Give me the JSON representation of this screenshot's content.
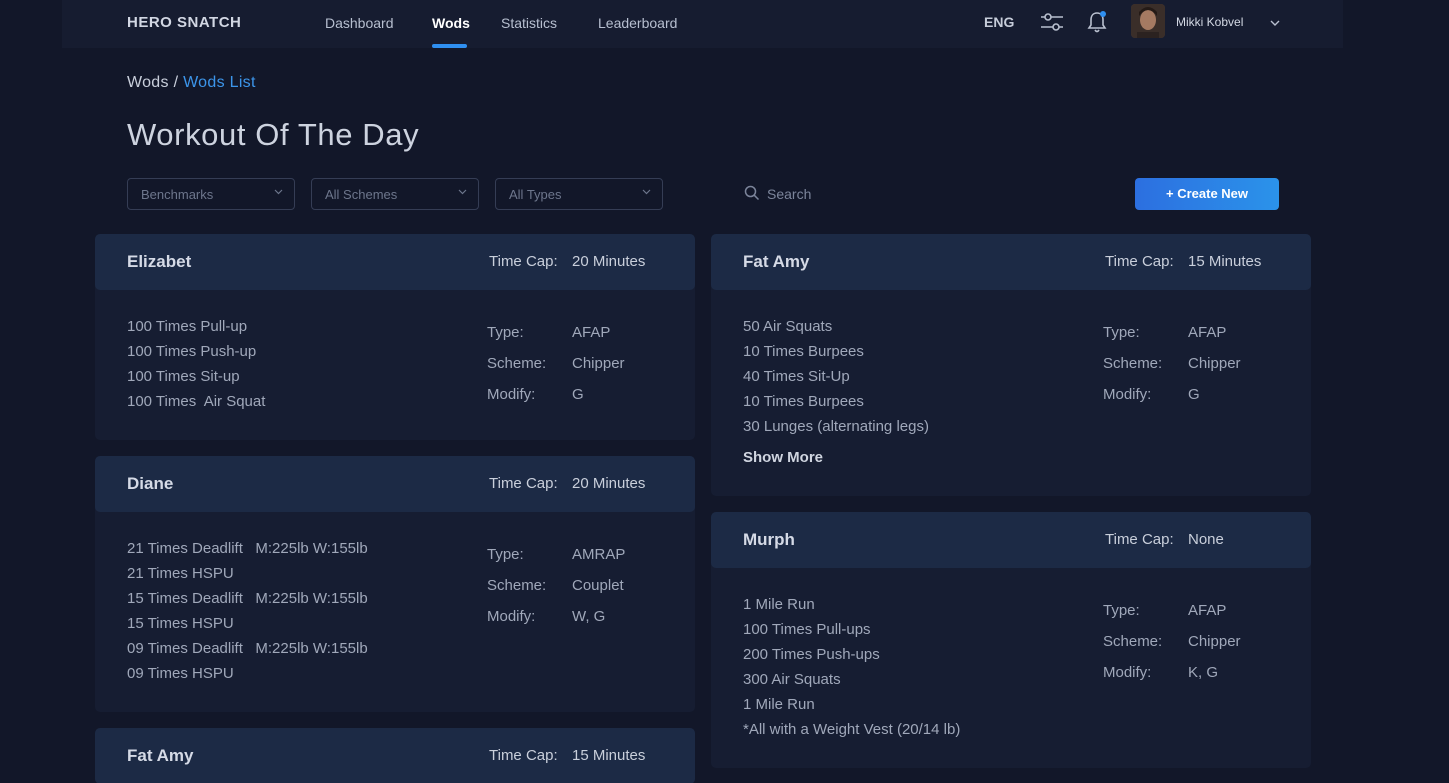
{
  "brand": "HERO SNATCH",
  "nav": [
    {
      "label": "Dashboard"
    },
    {
      "label": "Wods"
    },
    {
      "label": "Statistics"
    },
    {
      "label": "Leaderboard"
    }
  ],
  "header": {
    "language": "ENG",
    "user_name": "Mikki Kobvel",
    "accent_color": "#2f8ff0"
  },
  "breadcrumb": {
    "parent": "Wods",
    "separator": "/",
    "current": "Wods List"
  },
  "page_title": "Workout Of The Day",
  "filters": {
    "benchmarks": "Benchmarks",
    "schemes": "All Schemes",
    "types": "All Types",
    "search_placeholder": "Search",
    "create_label": "Create New"
  },
  "labels": {
    "time_cap": "Time Cap:",
    "type": "Type:",
    "scheme": "Scheme:",
    "modify": "Modify:",
    "show_more": "Show More"
  },
  "wods": [
    {
      "name": "Elizabet",
      "time_cap": "20 Minutes",
      "exercises": [
        "100 Times Pull-up",
        "100 Times Push-up",
        "100 Times Sit-up",
        "100 Times  Air Squat"
      ],
      "type": "AFAP",
      "scheme": "Chipper",
      "modify": "G"
    },
    {
      "name": "Diane",
      "time_cap": "20 Minutes",
      "exercises": [
        "21 Times Deadlift   M:225lb W:155lb",
        "21 Times HSPU",
        "15 Times Deadlift   M:225lb W:155lb",
        "15 Times HSPU",
        "09 Times Deadlift   M:225lb W:155lb",
        "09 Times HSPU"
      ],
      "type": "AMRAP",
      "scheme": "Couplet",
      "modify": "W, G"
    },
    {
      "name": "Fat Amy",
      "time_cap": "15 Minutes"
    },
    {
      "name": "Fat Amy",
      "time_cap": "15 Minutes",
      "exercises": [
        "50 Air Squats",
        "10 Times Burpees",
        "40 Times Sit-Up",
        "10 Times Burpees",
        "30 Lunges (alternating legs)"
      ],
      "type": "AFAP",
      "scheme": "Chipper",
      "modify": "G"
    },
    {
      "name": "Murph",
      "time_cap": "None",
      "exercises": [
        "1 Mile Run",
        "100 Times Pull-ups",
        "200 Times Push-ups",
        "300 Air Squats",
        "1 Mile Run",
        "*All with a Weight Vest (20/14 lb)"
      ],
      "type": "AFAP",
      "scheme": "Chipper",
      "modify": "K, G"
    }
  ]
}
